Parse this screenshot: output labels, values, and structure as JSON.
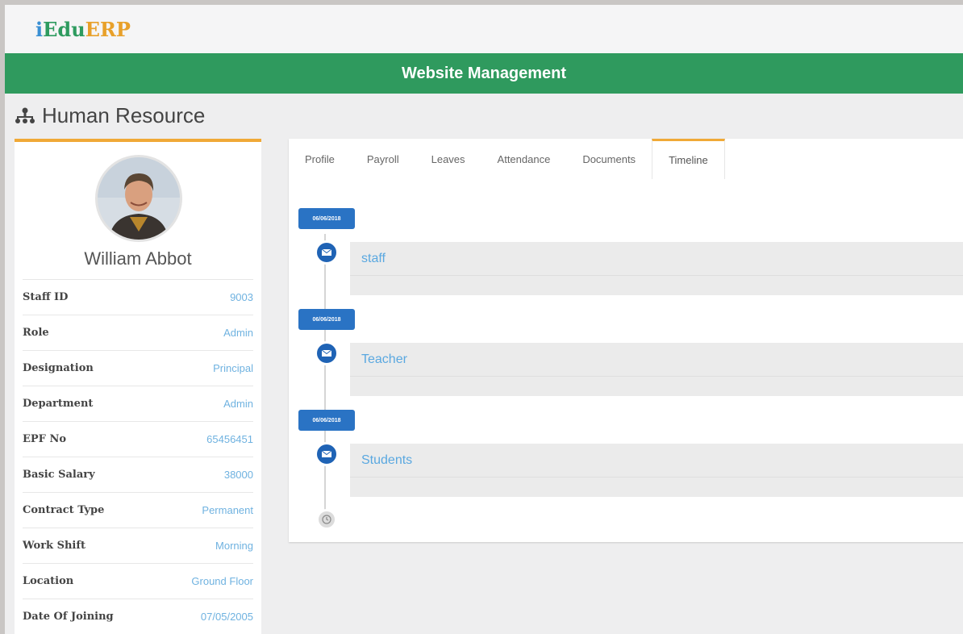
{
  "app": {
    "logo": {
      "i": "i",
      "edu": "Edu",
      "erp": "ERP"
    },
    "banner_title": "Website Management",
    "page_title": "Human Resource"
  },
  "profile": {
    "name": "William Abbot",
    "fields": [
      {
        "label": "Staff ID",
        "value": "9003"
      },
      {
        "label": "Role",
        "value": "Admin"
      },
      {
        "label": "Designation",
        "value": "Principal"
      },
      {
        "label": "Department",
        "value": "Admin"
      },
      {
        "label": "EPF No",
        "value": "65456451"
      },
      {
        "label": "Basic Salary",
        "value": "38000"
      },
      {
        "label": "Contract Type",
        "value": "Permanent"
      },
      {
        "label": "Work Shift",
        "value": "Morning"
      },
      {
        "label": "Location",
        "value": "Ground Floor"
      },
      {
        "label": "Date Of Joining",
        "value": "07/05/2005"
      }
    ]
  },
  "tabs": [
    {
      "label": "Profile"
    },
    {
      "label": "Payroll"
    },
    {
      "label": "Leaves"
    },
    {
      "label": "Attendance"
    },
    {
      "label": "Documents"
    },
    {
      "label": "Timeline",
      "active": true
    }
  ],
  "timeline": [
    {
      "date": "06/06/2018",
      "title": "staff"
    },
    {
      "date": "06/06/2018",
      "title": "Teacher"
    },
    {
      "date": "06/06/2018",
      "title": "Students"
    }
  ],
  "colors": {
    "brand_green": "#2f9a5e",
    "accent_orange": "#f0a937",
    "badge_blue": "#2a73c4",
    "link_blue": "#5aa8e0"
  }
}
